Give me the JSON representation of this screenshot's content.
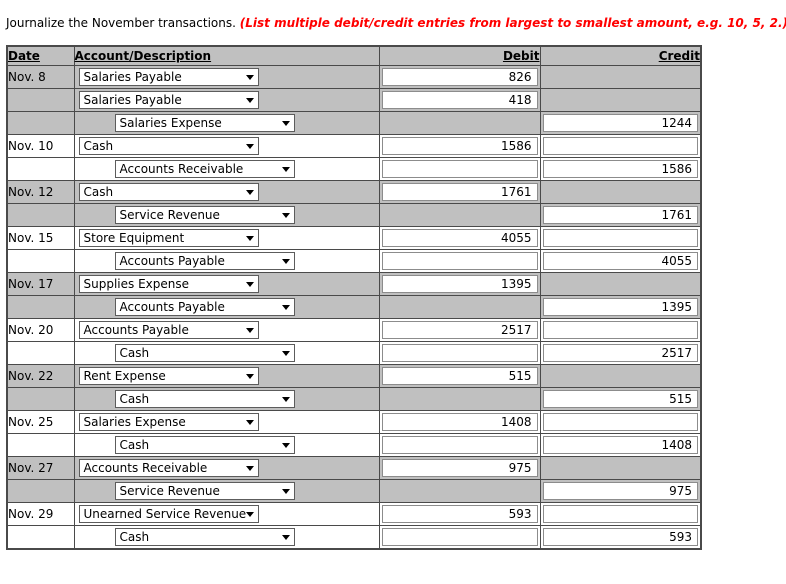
{
  "prompt": {
    "statement": "Journalize the November transactions.",
    "hint": "(List multiple debit/credit entries from largest to smallest amount, e.g. 10, 5, 2.)"
  },
  "colors": {
    "hint_red": "#ff0000",
    "row_shade": "#c0c0c0",
    "row_plain": "#ffffff",
    "border": "#4a4a4a"
  },
  "table": {
    "headers": {
      "date": "Date",
      "account": "Account/Description",
      "debit": "Debit",
      "credit": "Credit"
    },
    "dropdown_icon": "chevron-down-icon",
    "rows": [
      {
        "shade": "g",
        "date": "Nov. 8",
        "account": "Salaries Payable",
        "indent": false,
        "debit": "826",
        "credit": ""
      },
      {
        "shade": "g",
        "date": "",
        "account": "Salaries Payable",
        "indent": false,
        "debit": "418",
        "credit": ""
      },
      {
        "shade": "g",
        "date": "",
        "account": "Salaries Expense",
        "indent": true,
        "debit": "",
        "credit": "1244"
      },
      {
        "shade": "w",
        "date": "Nov. 10",
        "account": "Cash",
        "indent": false,
        "debit": "1586",
        "credit": ""
      },
      {
        "shade": "w",
        "date": "",
        "account": "Accounts Receivable",
        "indent": true,
        "debit": "",
        "credit": "1586"
      },
      {
        "shade": "g",
        "date": "Nov. 12",
        "account": "Cash",
        "indent": false,
        "debit": "1761",
        "credit": ""
      },
      {
        "shade": "g",
        "date": "",
        "account": "Service Revenue",
        "indent": true,
        "debit": "",
        "credit": "1761"
      },
      {
        "shade": "w",
        "date": "Nov. 15",
        "account": "Store Equipment",
        "indent": false,
        "debit": "4055",
        "credit": ""
      },
      {
        "shade": "w",
        "date": "",
        "account": "Accounts Payable",
        "indent": true,
        "debit": "",
        "credit": "4055"
      },
      {
        "shade": "g",
        "date": "Nov. 17",
        "account": "Supplies Expense",
        "indent": false,
        "debit": "1395",
        "credit": ""
      },
      {
        "shade": "g",
        "date": "",
        "account": "Accounts Payable",
        "indent": true,
        "debit": "",
        "credit": "1395"
      },
      {
        "shade": "w",
        "date": "Nov. 20",
        "account": "Accounts Payable",
        "indent": false,
        "debit": "2517",
        "credit": ""
      },
      {
        "shade": "w",
        "date": "",
        "account": "Cash",
        "indent": true,
        "debit": "",
        "credit": "2517"
      },
      {
        "shade": "g",
        "date": "Nov. 22",
        "account": "Rent Expense",
        "indent": false,
        "debit": "515",
        "credit": ""
      },
      {
        "shade": "g",
        "date": "",
        "account": "Cash",
        "indent": true,
        "debit": "",
        "credit": "515"
      },
      {
        "shade": "w",
        "date": "Nov. 25",
        "account": "Salaries Expense",
        "indent": false,
        "debit": "1408",
        "credit": ""
      },
      {
        "shade": "w",
        "date": "",
        "account": "Cash",
        "indent": true,
        "debit": "",
        "credit": "1408"
      },
      {
        "shade": "g",
        "date": "Nov. 27",
        "account": "Accounts Receivable",
        "indent": false,
        "debit": "975",
        "credit": ""
      },
      {
        "shade": "g",
        "date": "",
        "account": "Service Revenue",
        "indent": true,
        "debit": "",
        "credit": "975"
      },
      {
        "shade": "w",
        "date": "Nov. 29",
        "account": "Unearned Service Revenue",
        "indent": false,
        "debit": "593",
        "credit": ""
      },
      {
        "shade": "w",
        "date": "",
        "account": "Cash",
        "indent": true,
        "debit": "",
        "credit": "593"
      }
    ]
  }
}
